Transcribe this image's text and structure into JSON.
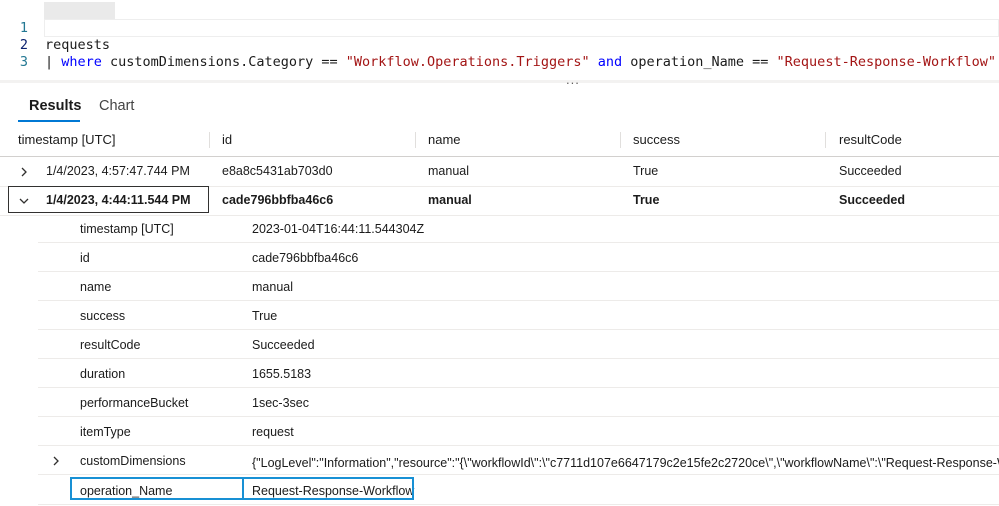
{
  "editor": {
    "lines": [
      {
        "num": "1",
        "text": "requests"
      },
      {
        "num": "2",
        "pipe": "| ",
        "kw_where": "where",
        "field1": " customDimensions.Category == ",
        "str1": "\"Workflow.Operations.Triggers\"",
        "kw_and": " and",
        "field2": " operation_Name == ",
        "str2": "\"Request-Response-Workflow\""
      },
      {
        "num": "3"
      }
    ],
    "splitter_dots": "..."
  },
  "tabs": [
    {
      "label": "Results",
      "active": true
    },
    {
      "label": "Chart",
      "active": false
    }
  ],
  "columns": [
    "timestamp [UTC]",
    "id",
    "name",
    "success",
    "resultCode"
  ],
  "rows": [
    {
      "expanded": false,
      "cells": [
        "1/4/2023, 4:57:47.744 PM",
        "e8a8c5431ab703d0",
        "manual",
        "True",
        "Succeeded"
      ]
    },
    {
      "expanded": true,
      "cells": [
        "1/4/2023, 4:44:11.544 PM",
        "cade796bbfba46c6",
        "manual",
        "True",
        "Succeeded"
      ]
    }
  ],
  "details": [
    {
      "key": "timestamp [UTC]",
      "value": "2023-01-04T16:44:11.544304Z"
    },
    {
      "key": "id",
      "value": "cade796bbfba46c6"
    },
    {
      "key": "name",
      "value": "manual"
    },
    {
      "key": "success",
      "value": "True"
    },
    {
      "key": "resultCode",
      "value": "Succeeded"
    },
    {
      "key": "duration",
      "value": "1655.5183"
    },
    {
      "key": "performanceBucket",
      "value": "1sec-3sec"
    },
    {
      "key": "itemType",
      "value": "request"
    },
    {
      "key": "customDimensions",
      "value": "{\"LogLevel\":\"Information\",\"resource\":\"{\\\"workflowId\\\":\\\"c7711d107e6647179c2e15fe2c2720ce\\\",\\\"workflowName\\\":\\\"Request-Response-Workflow\\\"}\"}",
      "expandable": true
    },
    {
      "key": "operation_Name",
      "value": "Request-Response-Workflow",
      "highlighted": true
    }
  ],
  "icons": {
    "collapsed": "chevron-right-icon",
    "expanded": "chevron-down-icon"
  },
  "colors": {
    "accent": "#0078d4",
    "highlight_border": "#1890d4",
    "keyword": "#0000ff",
    "string": "#a31515",
    "line_number": "#237893"
  }
}
